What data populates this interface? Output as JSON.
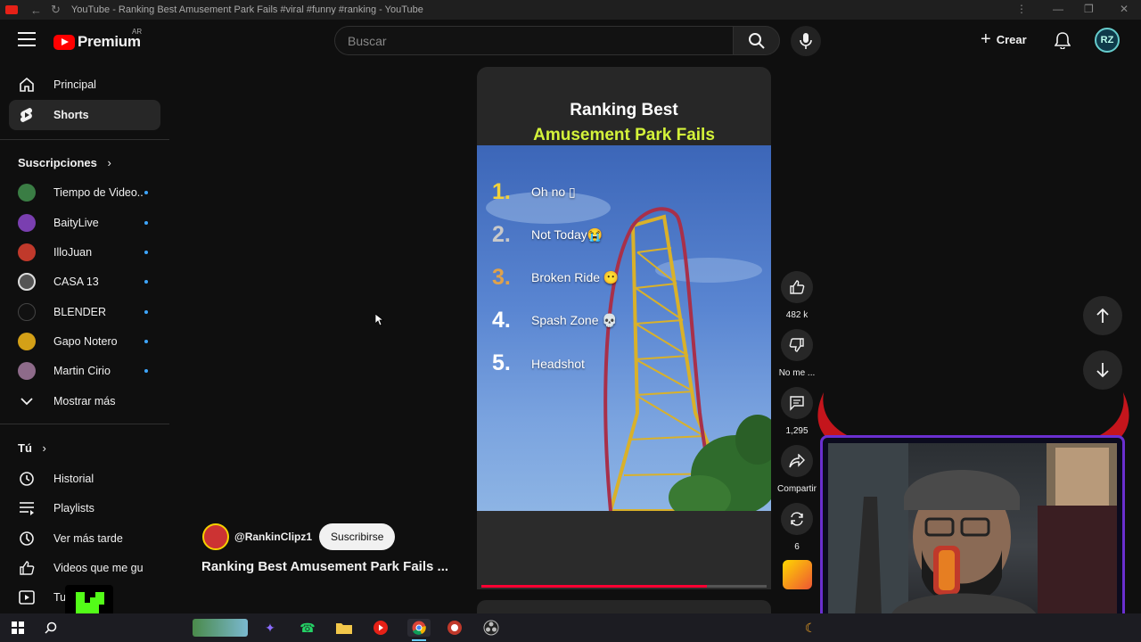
{
  "window": {
    "title": "YouTube - Ranking Best Amusement Park Fails #viral #funny #ranking - YouTube"
  },
  "header": {
    "logo_text": "Premium",
    "region": "AR",
    "search_placeholder": "Buscar",
    "create_label": "Crear",
    "avatar_initials": "RZ"
  },
  "sidebar": {
    "main": [
      {
        "label": "Principal",
        "icon": "home-icon"
      },
      {
        "label": "Shorts",
        "icon": "shorts-icon",
        "active": true
      }
    ],
    "subs_title": "Suscripciones",
    "subscriptions": [
      {
        "label": "Tiempo de Video...",
        "color": "#3a7d44"
      },
      {
        "label": "BaityLive",
        "color": "#7a3fb0"
      },
      {
        "label": "IlloJuan",
        "color": "#c0392b"
      },
      {
        "label": "CASA 13",
        "color": "#555555"
      },
      {
        "label": "BLENDER",
        "color": "#111111"
      },
      {
        "label": "Gapo Notero",
        "color": "#d4a017"
      },
      {
        "label": "Martin Cirio",
        "color": "#8e6b8a"
      }
    ],
    "show_more": "Mostrar más",
    "you_title": "Tú",
    "you_items": [
      {
        "label": "Historial",
        "icon": "history-icon"
      },
      {
        "label": "Playlists",
        "icon": "playlists-icon"
      },
      {
        "label": "Ver más tarde",
        "icon": "watch-later-icon"
      },
      {
        "label": "Videos que me gus...",
        "icon": "liked-icon"
      },
      {
        "label": "Tu",
        "icon": "your-videos-icon"
      }
    ]
  },
  "short": {
    "title_line1": "Ranking Best",
    "title_line2": "Amusement Park Fails",
    "ranks": [
      {
        "num": "1.",
        "text": "Oh no ▯",
        "color": "#f2d23a"
      },
      {
        "num": "2.",
        "text": "Not Today😭",
        "color": "#c9c9c9"
      },
      {
        "num": "3.",
        "text": "Broken Ride 😶",
        "color": "#e0a24a"
      },
      {
        "num": "4.",
        "text": "Spash Zone 💀",
        "color": "#ffffff"
      },
      {
        "num": "5.",
        "text": "Headshot",
        "color": "#ffffff"
      }
    ],
    "progress": 0.79,
    "channel": "@RankinClipz1",
    "subscribe_label": "Suscribirse",
    "video_title": "Ranking Best Amusement Park Fails ..."
  },
  "actions": {
    "likes": "482 k",
    "dislike_label": "No me ...",
    "comments": "1,295",
    "share_label": "Compartir",
    "remix_count": "6"
  }
}
